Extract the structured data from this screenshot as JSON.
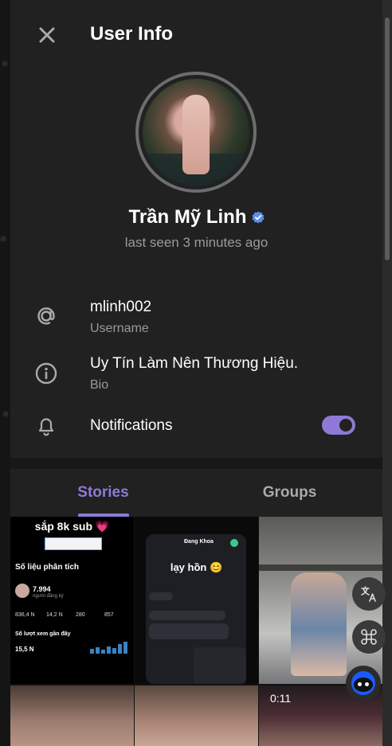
{
  "header": {
    "title": "User Info"
  },
  "profile": {
    "name": "Trần Mỹ Linh",
    "last_seen": "last seen 3 minutes ago"
  },
  "info": {
    "username_value": "mlinh002",
    "username_label": "Username",
    "bio_value": "Uy Tín Làm Nên Thương Hiệu.",
    "bio_label": "Bio",
    "notifications_label": "Notifications",
    "notifications_on": true
  },
  "tabs": [
    {
      "label": "Stories"
    },
    {
      "label": "Groups"
    }
  ],
  "stories": {
    "s1": {
      "caption": "sắp 8k sub 💗",
      "heading": "Số liệu phân tích",
      "subscribers": "7.994",
      "subscribers_label": "người đăng ký",
      "stat1": "836,4 N",
      "stat2": "14,2 N",
      "stat3": "280",
      "stat4": "857",
      "recent_label": "Số lượt xem gần đây",
      "recent_value": "15,5 N"
    },
    "s2": {
      "caption": "lạy hồn 😊",
      "chat_name": "Đang Khoa"
    },
    "s6": {
      "duration": "0:11"
    }
  },
  "colors": {
    "accent": "#8e79d6",
    "panel": "#212121",
    "muted": "#9a9a9a"
  }
}
